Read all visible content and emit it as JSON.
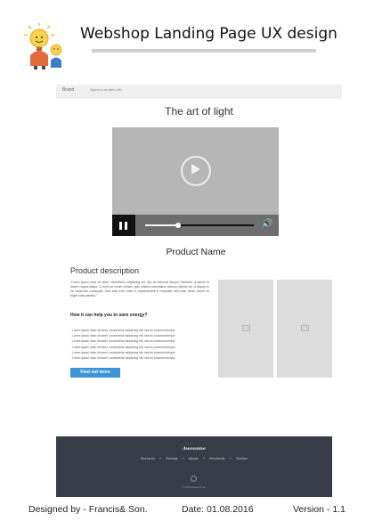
{
  "document": {
    "title": "Webshop Landing Page UX design",
    "designed_by": "Designed by - Francis& Son.",
    "date": "Date: 01.08.2016",
    "version": "Version - 1.1"
  },
  "mockup": {
    "navbar": {
      "brand": "Brand",
      "signed_in": "Signed in as Mark Otto"
    },
    "hero_title": "The art of light",
    "video": {
      "progress": 0.3
    },
    "product_name": "Product Name",
    "description": {
      "heading": "Product description",
      "paragraph": "\"Lorem ipsum dolor sit amet, consectetur adipiscing elit, sed do eiusmod tempor incididunt ut labore et dolore magna aliqua. Ut enim ad minim veniam, quis nostrud exercitation ullamco laboris nisi ut aliquip ex ea commodo consequat. Duis aute irure dolor in reprehenderit in voluptate velit esse cillum dolore eu fugiat nulla pariatur.\"",
      "energy_heading": "How it can help you to save energy?",
      "bullets": [
        "- Lorem ipsum dolor sit amet, consectetur adipiscing elit, sed do eiusmod tempor",
        "- Lorem ipsum dolor sit amet, consectetur adipiscing elit, sed do eiusmod tempor",
        "- Lorem ipsum dolor sit amet, consectetur adipiscing elit, sed do eiusmod tempor",
        "- Lorem ipsum dolor sit amet, consectetur adipiscing elit, sed do eiusmod tempor",
        "- Lorem ipsum dolor sit amet, consectetur adipiscing elit, sed do eiusmod tempor",
        "- Lorem ipsum dolor sit amet, consectetur adipiscing elit, sed do eiusmod tempor"
      ],
      "cta_label": "Find out more"
    },
    "footer": {
      "logo": "Awesome",
      "links": [
        "Features",
        "Pricing",
        "About",
        "Facebook",
        "Twitter"
      ],
      "separator": "•",
      "copyright": "© 2016 Awesome Inc."
    }
  },
  "colors": {
    "cta": "#3a95d9",
    "footer_bg": "#373c46",
    "navbar_bg": "#efefef"
  }
}
